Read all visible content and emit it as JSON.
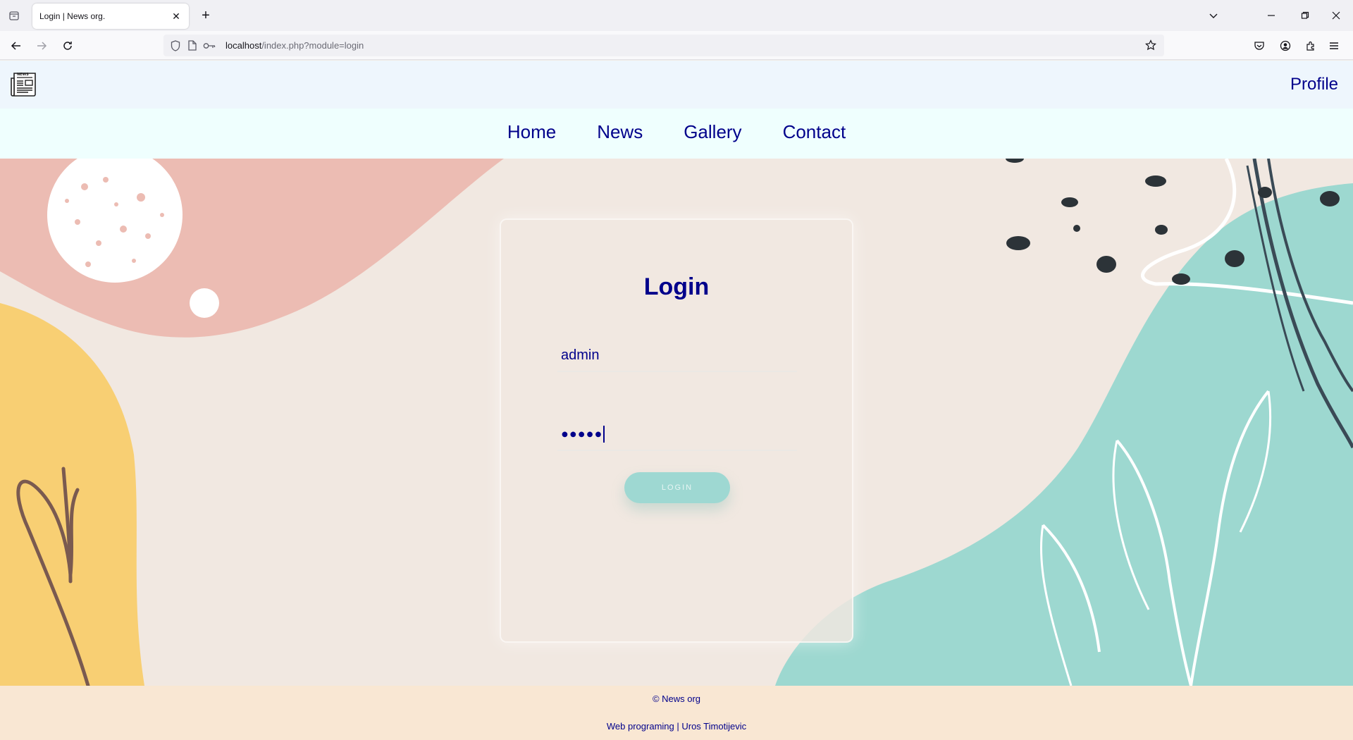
{
  "browser": {
    "tab_title": "Login | News org.",
    "url_host": "localhost",
    "url_path": "/index.php?module=login"
  },
  "header": {
    "logo_text": "NEWS",
    "profile_label": "Profile"
  },
  "nav": {
    "items": [
      "Home",
      "News",
      "Gallery",
      "Contact"
    ]
  },
  "login": {
    "title": "Login",
    "username_value": "admin",
    "password_mask": "●●●●●",
    "button_label": "LOGIN"
  },
  "footer": {
    "copyright": "© News org",
    "credit": "Web programing | Uros Timotijevic"
  },
  "colors": {
    "link": "#00008b",
    "button": "#9ed8d2",
    "header_bg": "#eef6fd",
    "nav_bg": "#effffe",
    "footer_bg": "#f9e7d3"
  },
  "icons": [
    "tab-list-icon",
    "close-icon",
    "plus-icon",
    "chevron-down-icon",
    "minimize-icon",
    "restore-icon",
    "back-icon",
    "forward-icon",
    "reload-icon",
    "shield-icon",
    "page-icon",
    "key-icon",
    "star-icon",
    "pocket-icon",
    "account-icon",
    "extensions-icon",
    "menu-icon",
    "newspaper-logo-icon"
  ]
}
